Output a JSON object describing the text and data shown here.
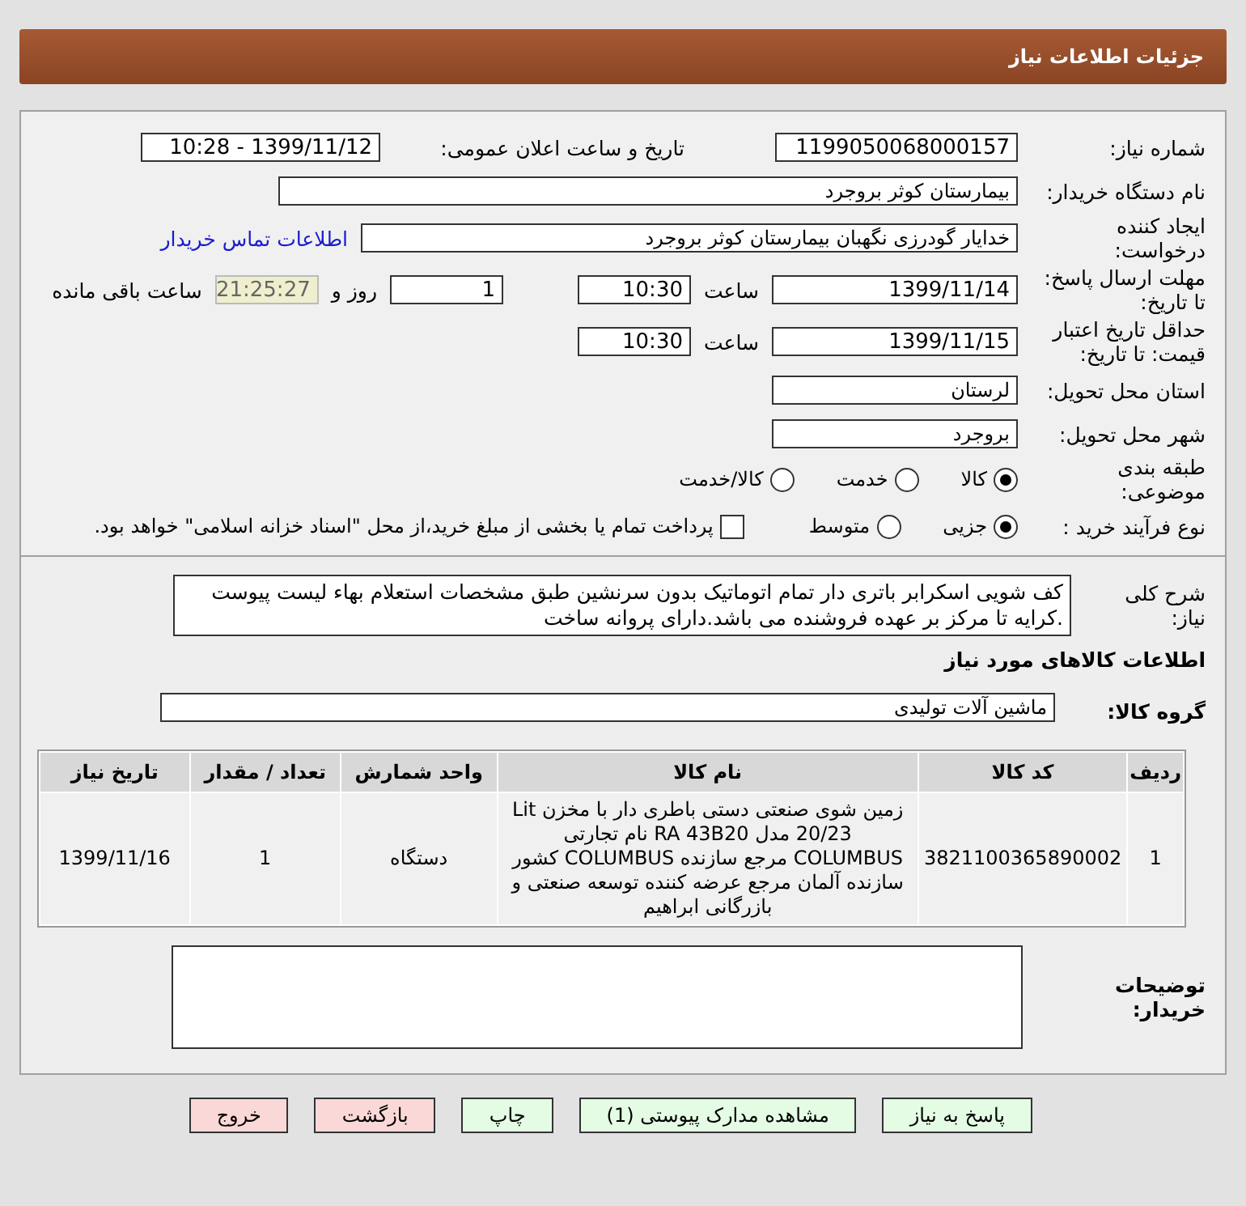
{
  "header": {
    "title": "جزئیات اطلاعات نیاز"
  },
  "need_number": {
    "label": "شماره نیاز:",
    "value": "1199050068000157"
  },
  "announce": {
    "label": "تاریخ و ساعت اعلان عمومی:",
    "value": "1399/11/12 - 10:28"
  },
  "buyer_org": {
    "label": "نام دستگاه خریدار:",
    "value": "بیمارستان کوثر بروجرد"
  },
  "creator": {
    "label": "ایجاد کننده درخواست:",
    "value": "خدایار  گودرزی نگهبان بیمارستان کوثر بروجرد",
    "link": "اطلاعات تماس خریدار"
  },
  "deadline": {
    "label": "مهلت ارسال پاسخ: تا تاریخ:",
    "date": "1399/11/14",
    "time_label": "ساعت",
    "time": "10:30",
    "days": "1",
    "days_label": "روز و",
    "remaining": "21:25:27",
    "remaining_label": "ساعت باقی مانده"
  },
  "validity": {
    "label": "حداقل تاریخ اعتبار قیمت: تا تاریخ:",
    "date": "1399/11/15",
    "time_label": "ساعت",
    "time": "10:30"
  },
  "province": {
    "label": "استان محل تحویل:",
    "value": "لرستان"
  },
  "city": {
    "label": "شهر محل تحویل:",
    "value": "بروجرد"
  },
  "category": {
    "label": "طبقه بندی موضوعی:",
    "options": [
      {
        "label": "کالا",
        "selected": true
      },
      {
        "label": "خدمت",
        "selected": false
      },
      {
        "label": "کالا/خدمت",
        "selected": false
      }
    ]
  },
  "purchase_type": {
    "label": "نوع فرآیند خرید :",
    "options": [
      {
        "label": "جزیی",
        "selected": true
      },
      {
        "label": "متوسط",
        "selected": false
      }
    ],
    "payment": {
      "label": "پرداخت تمام یا بخشی از مبلغ خرید،از محل \"اسناد خزانه اسلامی\" خواهد بود.",
      "checked": false
    }
  },
  "description": {
    "label": "شرح کلی نیاز:",
    "value": "کف شویی اسکرابر باتری دار تمام اتوماتیک بدون سرنشین طبق مشخصات استعلام بهاء لیست پیوست .کرایه تا مرکز بر عهده فروشنده می باشد.دارای پروانه ساخت"
  },
  "goods_section": {
    "title": "اطلاعات کالاهای مورد نیاز"
  },
  "goods_group": {
    "label": "گروه کالا:",
    "value": "ماشین آلات تولیدی"
  },
  "table": {
    "columns": [
      "ردیف",
      "کد کالا",
      "نام کالا",
      "واحد شمارش",
      "تعداد / مقدار",
      "تاریخ نیاز"
    ],
    "rows": [
      [
        "1",
        "3821100365890002",
        "زمین شوی صنعتی دستی باطری دار با مخزن Lit 20/23 مدل RA 43B20 نام تجارتی COLUMBUS مرجع سازنده COLUMBUS کشور سازنده آلمان مرجع عرضه کننده توسعه صنعتی و بازرگانی ابراهیم",
        "دستگاه",
        "1",
        "1399/11/16"
      ]
    ]
  },
  "buyer_notes": {
    "label": "توضیحات خریدار:"
  },
  "buttons": [
    {
      "label": "پاسخ به نیاز",
      "kind": "green"
    },
    {
      "label": "مشاهده مدارک پیوستی (1)",
      "kind": "green"
    },
    {
      "label": "چاپ",
      "kind": "green"
    },
    {
      "label": "بازگشت",
      "kind": "red"
    },
    {
      "label": "خروج",
      "kind": "red"
    }
  ]
}
